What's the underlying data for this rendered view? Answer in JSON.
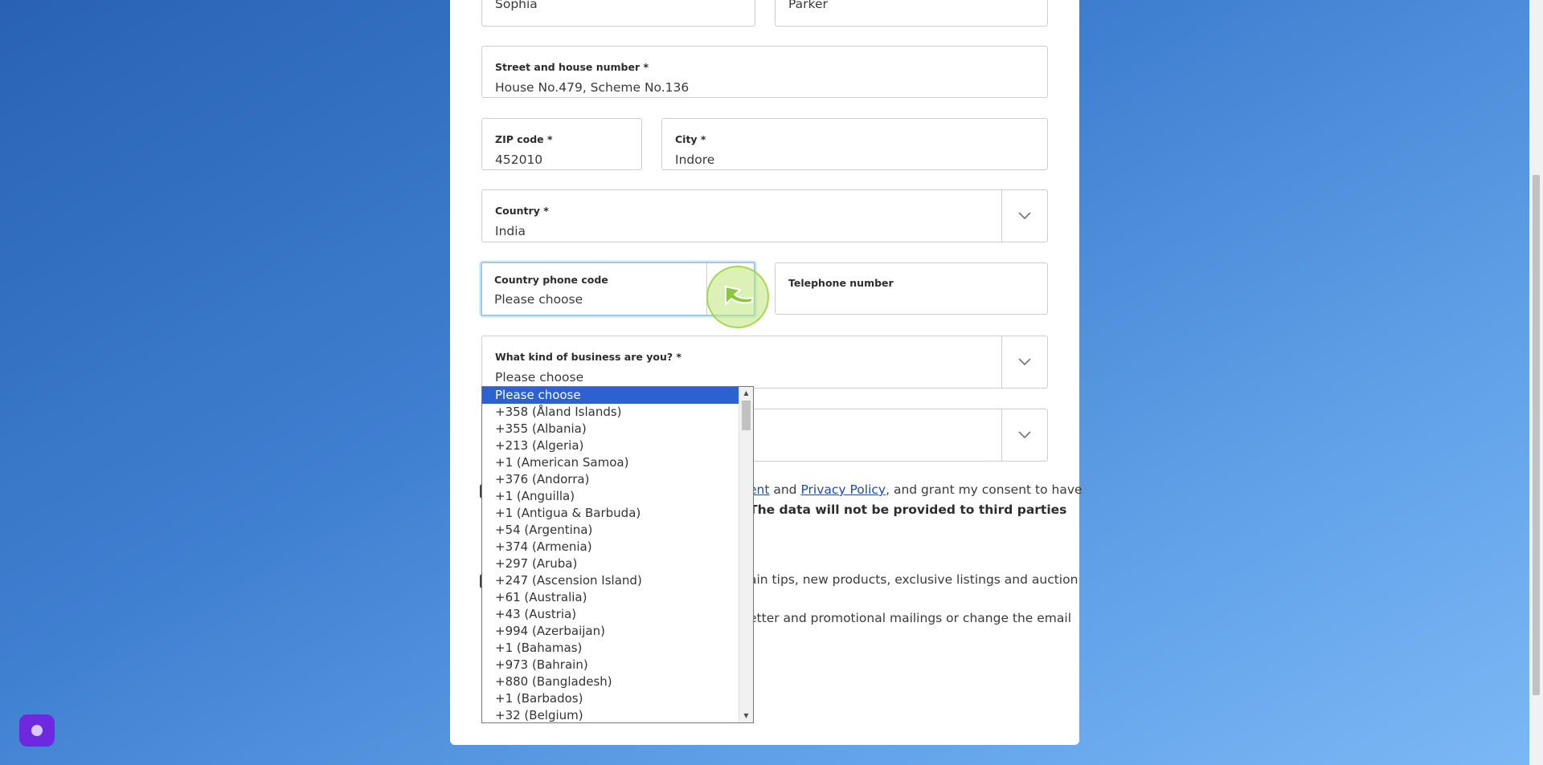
{
  "form": {
    "first_name": {
      "value": "Sophia"
    },
    "last_name": {
      "value": "Parker"
    },
    "street": {
      "label": "Street and house number *",
      "value": "House No.479, Scheme No.136"
    },
    "zip": {
      "label": "ZIP code *",
      "value": "452010"
    },
    "city": {
      "label": "City *",
      "value": "Indore"
    },
    "country": {
      "label": "Country *",
      "value": "India"
    },
    "phone_code": {
      "label": "Country phone code",
      "value": "Please choose"
    },
    "telephone": {
      "label": "Telephone number",
      "value": ""
    },
    "business": {
      "label": "What kind of business are you? *",
      "value": "Please choose"
    }
  },
  "consent": {
    "line1_frag1": "ent",
    "line1_frag2": " and ",
    "privacy_link": "Privacy Policy",
    "line1_frag3": ", and grant my consent to have",
    "line2_bold": "The data will not be provided to third parties",
    "newsletter_line1": "ain tips, new products, exclusive listings and auction",
    "newsletter_line2": "etter and promotional mailings or change the email"
  },
  "phone_code_options": [
    "Please choose",
    "+358 (Åland Islands)",
    "+355 (Albania)",
    "+213 (Algeria)",
    "+1 (American Samoa)",
    "+376 (Andorra)",
    "+1 (Anguilla)",
    "+1 (Antigua & Barbuda)",
    "+54 (Argentina)",
    "+374 (Armenia)",
    "+297 (Aruba)",
    "+247 (Ascension Island)",
    "+61 (Australia)",
    "+43 (Austria)",
    "+994 (Azerbaijan)",
    "+1 (Bahamas)",
    "+973 (Bahrain)",
    "+880 (Bangladesh)",
    "+1 (Barbados)",
    "+32 (Belgium)"
  ],
  "selected_option_index": 0,
  "icons": {
    "chevron": "chevron-down-icon",
    "cursor": "cursor-arrow-icon",
    "chat": "chat-launcher-icon"
  },
  "colors": {
    "selected_option": "#2b61d1",
    "focus_border": "#9ec8e8",
    "link": "#1f4aa8",
    "chat_button": "#6d28e0",
    "cursor_highlight": "#a6d84a"
  }
}
